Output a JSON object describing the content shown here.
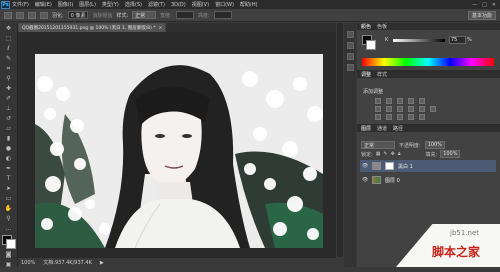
{
  "app": {
    "logo": "Ps"
  },
  "menu": [
    "文件(F)",
    "编辑(E)",
    "图像(I)",
    "图层(L)",
    "类型(Y)",
    "选择(S)",
    "滤镜(T)",
    "3D(D)",
    "视图(V)",
    "窗口(W)",
    "帮助(H)"
  ],
  "window_buttons": [
    "—",
    "□",
    "✕"
  ],
  "options_bar": {
    "feather_label": "羽化:",
    "feather_value": "0 像素",
    "antialias_label": "消除锯齿",
    "style_label": "样式:",
    "style_value": "正常",
    "width_label": "宽度:",
    "height_label": "高度:",
    "workspace": "基本功能"
  },
  "document": {
    "tab_label": "QQ截图20151201155931.png @ 100% (黑白 1, 图层蒙版/8) *"
  },
  "status": {
    "zoom": "100%",
    "doc_size": "文档:937.4K/937.4K"
  },
  "panels": {
    "color_tabs": [
      "颜色",
      "色板"
    ],
    "k_label": "K",
    "k_value": "75",
    "k_unit": "%",
    "adj_tabs": [
      "调整",
      "样式"
    ],
    "adj_title": "添加调整",
    "layer_tabs": [
      "图层",
      "通道",
      "路径"
    ],
    "blend_mode": "正常",
    "opacity_label": "不透明度:",
    "opacity_value": "100%",
    "lock_label": "锁定:",
    "fill_label": "填充:",
    "fill_value": "100%",
    "layers": [
      {
        "name": "黑白 1"
      },
      {
        "name": "图层 0"
      }
    ]
  },
  "watermark": {
    "site": "jb51.net",
    "name": "脚本之家"
  },
  "colors": {
    "selected_layer": "#4c5b73",
    "accent_blue": "#4fb4f0",
    "watermark_red": "#c9231b"
  }
}
